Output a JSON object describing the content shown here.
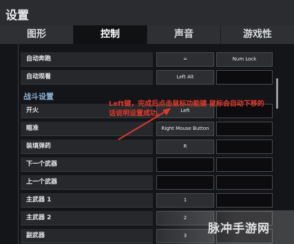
{
  "window": {
    "title": "设置"
  },
  "tabs": [
    {
      "label": "图形",
      "active": false
    },
    {
      "label": "控制",
      "active": true
    },
    {
      "label": "声音",
      "active": false
    },
    {
      "label": "游戏性",
      "active": false
    }
  ],
  "rows_top": [
    {
      "label": "自动奔跑",
      "key1": "=",
      "key2": "Num Lock"
    },
    {
      "label": "自动观看",
      "key1": "Left Alt",
      "key2": ""
    }
  ],
  "section": {
    "title": "战斗设置"
  },
  "rows_combat": [
    {
      "label": "开火",
      "key1": "Left",
      "key2": ""
    },
    {
      "label": "瞄准",
      "key1": "Right Mouse Button",
      "key2": ""
    },
    {
      "label": "装填弹药",
      "key1": "R",
      "key2": ""
    },
    {
      "label": "下一个武器",
      "key1": "",
      "key2": ""
    },
    {
      "label": "上一个武器",
      "key1": "",
      "key2": ""
    },
    {
      "label": "主武器 1",
      "key1": "1",
      "key2": ""
    },
    {
      "label": "主武器 2",
      "key1": "2",
      "key2": ""
    },
    {
      "label": "副武器",
      "key1": "3",
      "key2": ""
    }
  ],
  "annotation": {
    "line1": "Left键，完成后点击鼠标功能键 鼠标会自动下移的",
    "line2": "话说明设置成功。"
  },
  "watermark": {
    "text": "脉冲手游网"
  },
  "colors": {
    "annotation": "#e03a2a",
    "section": "#8db3d6",
    "active_tab": "#101113"
  }
}
